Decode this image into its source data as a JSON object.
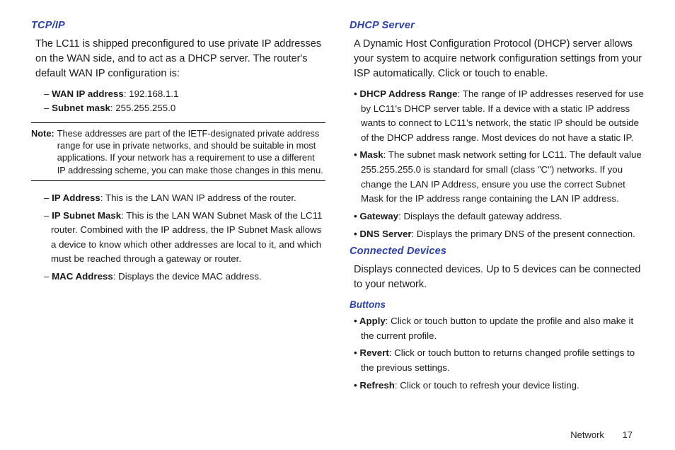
{
  "left": {
    "h1": "TCP/IP",
    "intro": "The LC11 is shipped preconfigured to use private IP addresses on the WAN side, and to act as a DHCP server. The router's default WAN IP configuration is:",
    "wan": {
      "label": "WAN IP address",
      "value": ": 192.168.1.1"
    },
    "subnet": {
      "label": "Subnet mask",
      "value": ": 255.255.255.0"
    },
    "note": {
      "label": "Note:",
      "text": "These addresses are part of the IETF-designated private address range for use in private networks, and should be suitable in most applications. If your network has a requirement to use a different IP addressing scheme, you can make those changes in this menu."
    },
    "ipaddr": {
      "label": "IP Address",
      "text": ": This is the LAN WAN IP address of the router."
    },
    "ipsm": {
      "label": "IP Subnet Mask",
      "text": ": This is the LAN WAN Subnet Mask of the LC11 router. Combined with the IP address, the IP Subnet Mask allows a device to know which other addresses are local to it, and which must be reached through a gateway or router."
    },
    "mac": {
      "label": "MAC Address",
      "text": ": Displays the device MAC address."
    }
  },
  "right": {
    "h1": "DHCP Server",
    "intro": "A Dynamic Host Configuration Protocol (DHCP) server allows your system to acquire network configuration settings from your ISP automatically. Click or touch to enable.",
    "dhcp_range": {
      "label": "DHCP Address Range",
      "text": ": The range of IP addresses reserved for use by LC11's DHCP server table. If a device with a static IP address wants to connect to LC11's network, the static IP should be outside of the DHCP address range. Most devices do not have a static IP."
    },
    "mask": {
      "label": "Mask",
      "text": ": The subnet mask network setting for LC11. The default value 255.255.255.0 is standard for small (class \"C\") networks. If you change the LAN IP Address, ensure you use the correct Subnet Mask for the IP address range containing the LAN IP address."
    },
    "gateway": {
      "label": "Gateway",
      "text": ": Displays the default gateway address."
    },
    "dns": {
      "label": "DNS Server",
      "text": ": Displays the primary DNS of the present connection."
    },
    "cd_h": "Connected Devices",
    "cd_text": "Displays connected devices. Up to 5 devices can be connected to your network.",
    "btn_h": "Buttons",
    "apply": {
      "label": "Apply",
      "text": ": Click or touch button to update the profile and also make it the current profile."
    },
    "revert": {
      "label": "Revert",
      "text": ": Click or touch button to returns changed profile settings to the previous settings."
    },
    "refresh": {
      "label": "Refresh",
      "text": ": Click or touch to refresh your device listing."
    }
  },
  "footer": {
    "section": "Network",
    "page": "17"
  }
}
